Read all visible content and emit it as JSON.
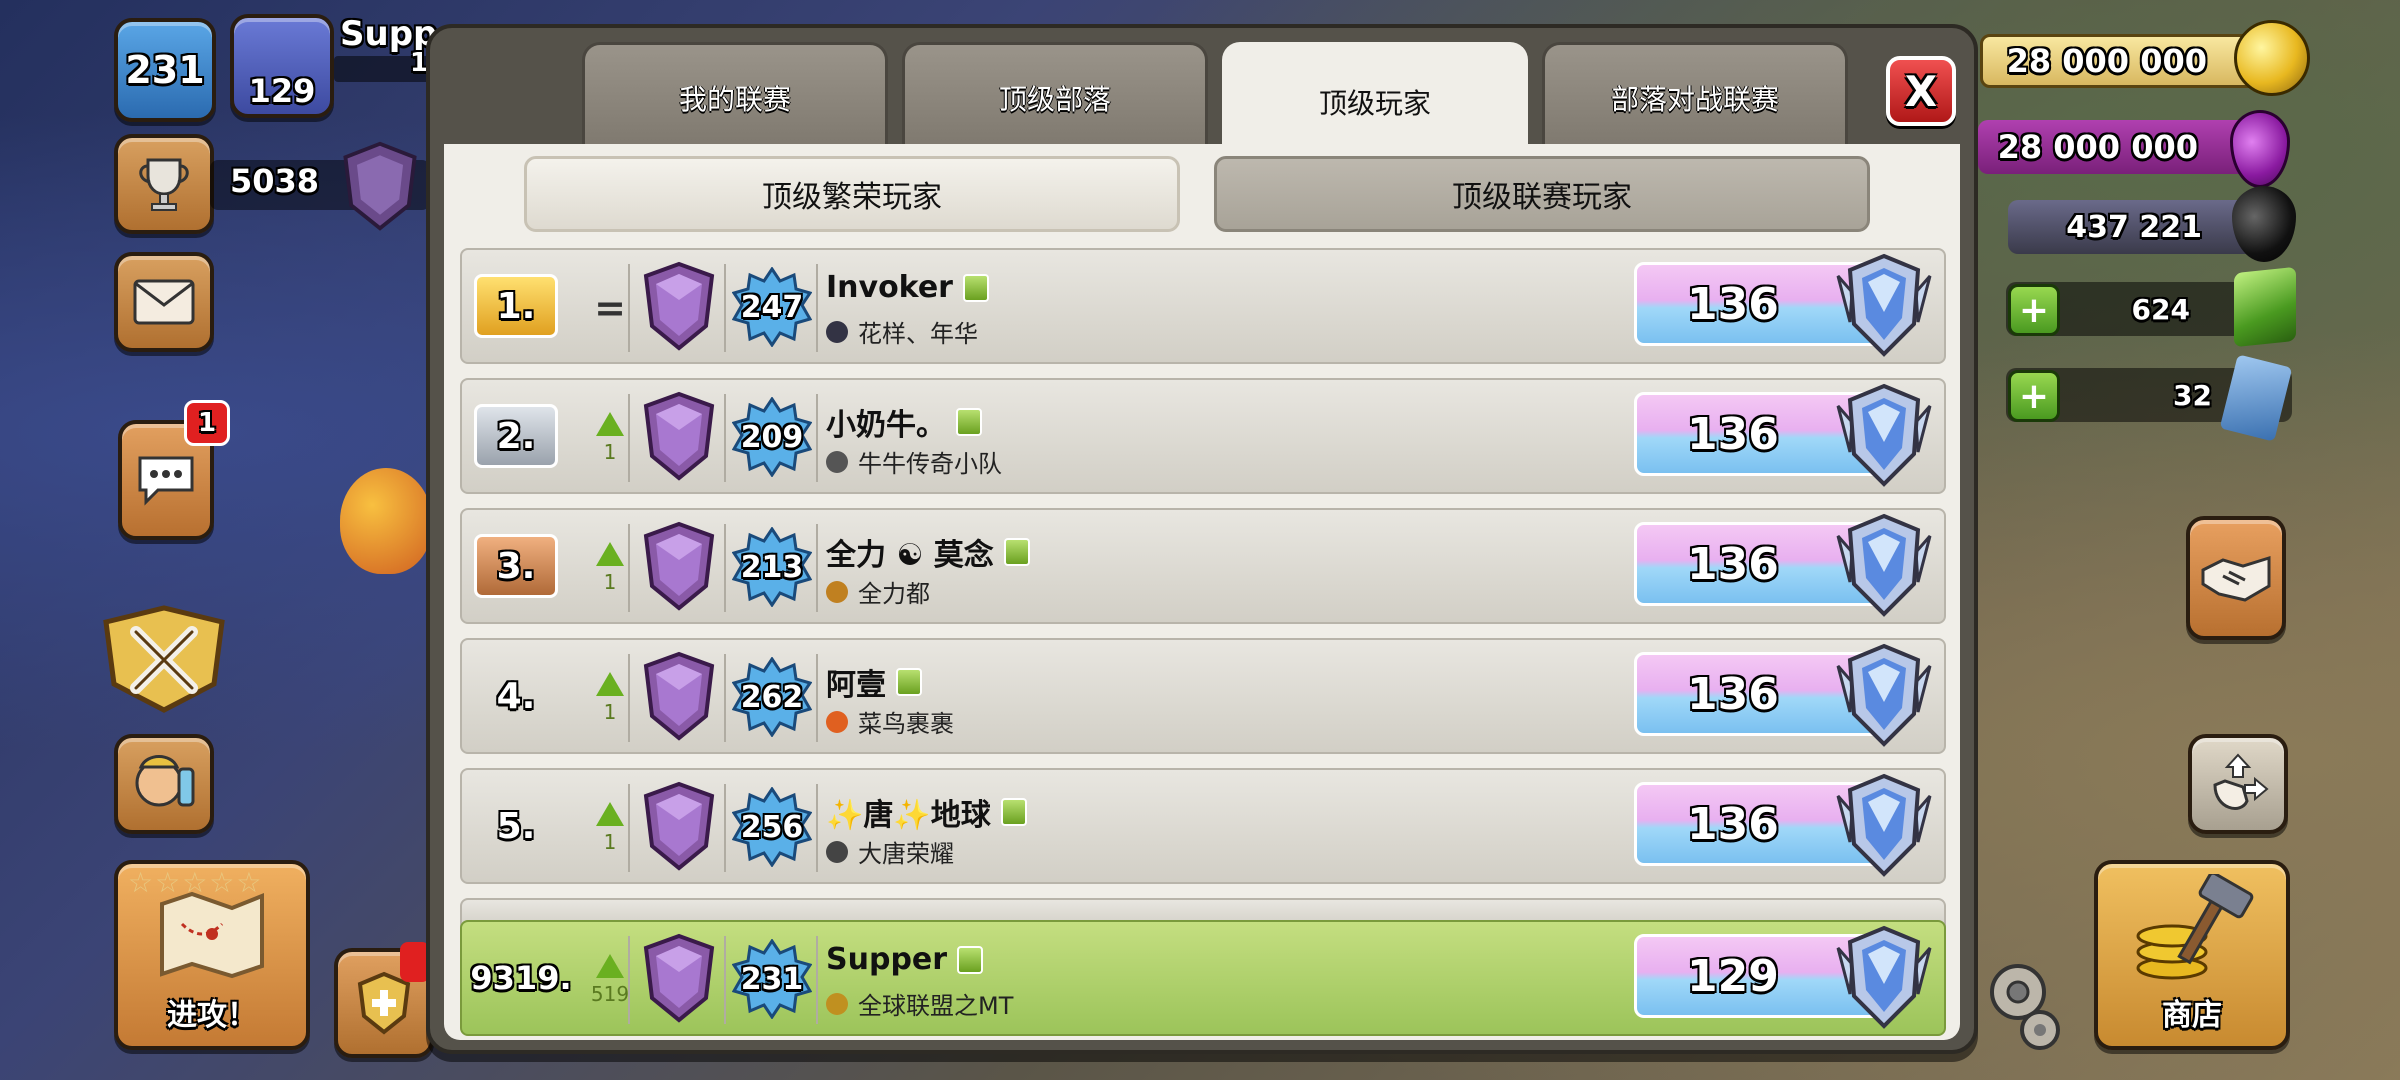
{
  "hud": {
    "player_level": "231",
    "league_level": "129",
    "player_name": "Supp",
    "level_progress_label": "1",
    "trophies": "5038",
    "chat_unread": "1",
    "attack_label": "进攻！",
    "shop_label": "商店"
  },
  "resources": {
    "gold": "28 000 000",
    "elixir": "28 000 000",
    "dark_elixir": "437 221",
    "gems": "624",
    "tickets": "32"
  },
  "tabs": [
    {
      "label": "我的联赛",
      "active": false
    },
    {
      "label": "顶级部落",
      "active": false
    },
    {
      "label": "顶级玩家",
      "active": true
    },
    {
      "label": "部落对战联赛",
      "active": false
    }
  ],
  "close_label": "X",
  "subtabs": [
    {
      "label": "顶级繁荣玩家",
      "active": true
    },
    {
      "label": "顶级联赛玩家",
      "active": false
    }
  ],
  "rows": [
    {
      "rank": "1.",
      "change": "=",
      "change_dir": "same",
      "level": "247",
      "name": "Invoker",
      "clan": "花样、年华",
      "clan_color": "#334",
      "trophies": "136"
    },
    {
      "rank": "2.",
      "change": "1",
      "change_dir": "up",
      "level": "209",
      "name": "小奶牛。",
      "clan": "牛牛传奇小队",
      "clan_color": "#555",
      "trophies": "136"
    },
    {
      "rank": "3.",
      "change": "1",
      "change_dir": "up",
      "level": "213",
      "name": "全力 ☯ 莫念",
      "clan": "全力都",
      "clan_color": "#c08020",
      "trophies": "136"
    },
    {
      "rank": "4.",
      "change": "1",
      "change_dir": "up",
      "level": "262",
      "name": "阿壹",
      "clan": "菜鸟裹裹",
      "clan_color": "#e06020",
      "trophies": "136"
    },
    {
      "rank": "5.",
      "change": "1",
      "change_dir": "up",
      "level": "256",
      "name": "✨唐✨地球",
      "clan": "大唐荣耀",
      "clan_color": "#444",
      "trophies": "136"
    }
  ],
  "me": {
    "rank": "9319.",
    "change": "519",
    "change_dir": "up",
    "level": "231",
    "name": "Supper",
    "clan": "全球联盟之MT",
    "clan_color": "#c09020",
    "trophies": "129"
  },
  "colors": {
    "panel_bg": "#f0eee8",
    "row_highlight": "#c4de80",
    "rank_gold": "#ffe070",
    "rank_silver": "#dfe4ea",
    "rank_bronze": "#f0b080",
    "trophy_purple": "#e8b0f0",
    "trophy_blue": "#7ac0f0",
    "up_arrow": "#6ab020",
    "close_red": "#e03030"
  }
}
